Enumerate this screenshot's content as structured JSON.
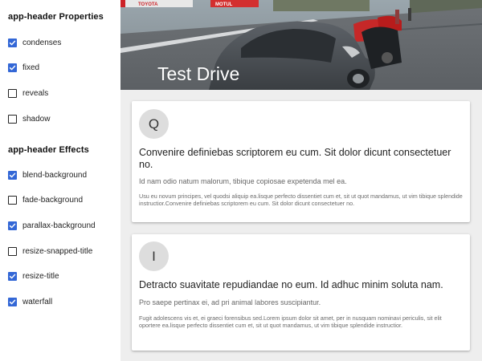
{
  "sidebar": {
    "properties_title": "app-header Properties",
    "properties": [
      {
        "label": "condenses",
        "checked": true
      },
      {
        "label": "fixed",
        "checked": true
      },
      {
        "label": "reveals",
        "checked": false
      },
      {
        "label": "shadow",
        "checked": false
      }
    ],
    "effects_title": "app-header Effects",
    "effects": [
      {
        "label": "blend-background",
        "checked": true
      },
      {
        "label": "fade-background",
        "checked": false
      },
      {
        "label": "parallax-background",
        "checked": true
      },
      {
        "label": "resize-snapped-title",
        "checked": false
      },
      {
        "label": "resize-title",
        "checked": true
      },
      {
        "label": "waterfall",
        "checked": true
      }
    ]
  },
  "header": {
    "title": "Test Drive",
    "sign_left": "TOYOTA",
    "sign_mid": "MOTUL"
  },
  "cards": [
    {
      "avatar": "Q",
      "title": "Convenire definiebas scriptorem eu cum. Sit dolor dicunt consectetuer no.",
      "lead": "Id nam odio natum malorum, tibique copiosae expetenda mel ea.",
      "body": "Usu eu novum principes, vel quodsi aliquip ea.lisque perfecto dissentiet cum et, sit ut quot mandamus, ut vim tibique splendide instructior.Convenire definiebas scriptorem eu cum. Sit dolor dicunt consectetuer no."
    },
    {
      "avatar": "I",
      "title": "Detracto suavitate repudiandae no eum. Id adhuc minim soluta nam.",
      "lead": "Pro saepe pertinax ei, ad pri animal labores suscipiantur.",
      "body": "Fugit adolescens vis et, ei graeci forensibus sed.Lorem ipsum dolor sit amet, per in nusquam nominavi periculis, sit elit oportere ea.lisque perfecto dissentiet cum et, sit ut quot mandamus, ut vim tibique splendide instructior."
    }
  ],
  "colors": {
    "accent": "#3367d6",
    "main_bg": "#eeeeee",
    "avatar_bg": "#dddddd"
  }
}
